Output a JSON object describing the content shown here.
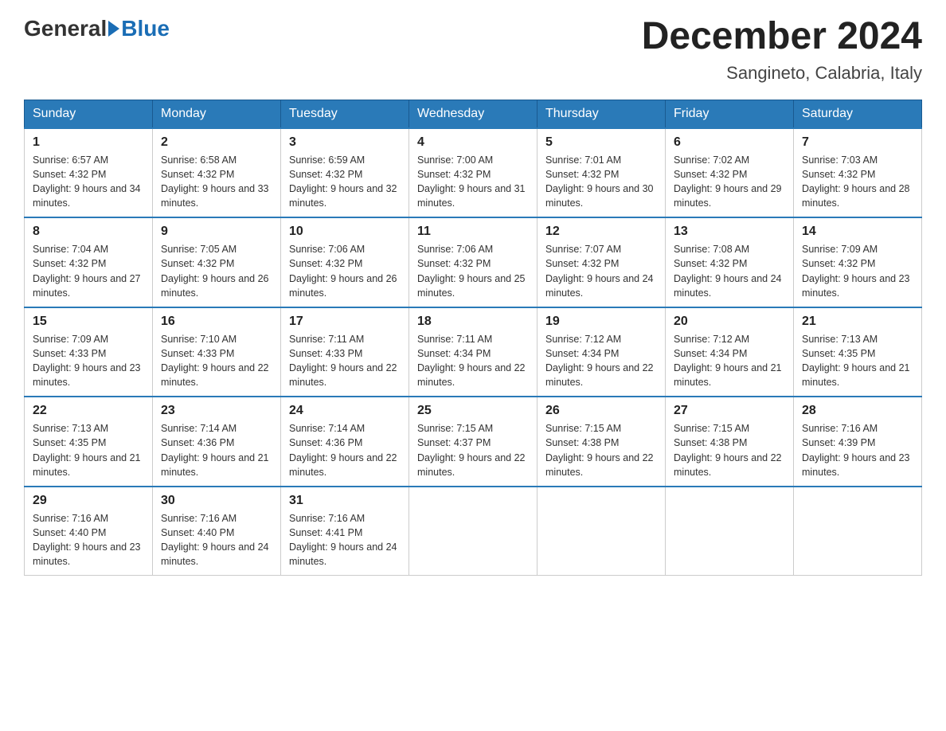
{
  "header": {
    "logo_general": "General",
    "logo_blue": "Blue",
    "month_title": "December 2024",
    "location": "Sangineto, Calabria, Italy"
  },
  "days_of_week": [
    "Sunday",
    "Monday",
    "Tuesday",
    "Wednesday",
    "Thursday",
    "Friday",
    "Saturday"
  ],
  "weeks": [
    [
      {
        "day": "1",
        "sunrise": "Sunrise: 6:57 AM",
        "sunset": "Sunset: 4:32 PM",
        "daylight": "Daylight: 9 hours and 34 minutes."
      },
      {
        "day": "2",
        "sunrise": "Sunrise: 6:58 AM",
        "sunset": "Sunset: 4:32 PM",
        "daylight": "Daylight: 9 hours and 33 minutes."
      },
      {
        "day": "3",
        "sunrise": "Sunrise: 6:59 AM",
        "sunset": "Sunset: 4:32 PM",
        "daylight": "Daylight: 9 hours and 32 minutes."
      },
      {
        "day": "4",
        "sunrise": "Sunrise: 7:00 AM",
        "sunset": "Sunset: 4:32 PM",
        "daylight": "Daylight: 9 hours and 31 minutes."
      },
      {
        "day": "5",
        "sunrise": "Sunrise: 7:01 AM",
        "sunset": "Sunset: 4:32 PM",
        "daylight": "Daylight: 9 hours and 30 minutes."
      },
      {
        "day": "6",
        "sunrise": "Sunrise: 7:02 AM",
        "sunset": "Sunset: 4:32 PM",
        "daylight": "Daylight: 9 hours and 29 minutes."
      },
      {
        "day": "7",
        "sunrise": "Sunrise: 7:03 AM",
        "sunset": "Sunset: 4:32 PM",
        "daylight": "Daylight: 9 hours and 28 minutes."
      }
    ],
    [
      {
        "day": "8",
        "sunrise": "Sunrise: 7:04 AM",
        "sunset": "Sunset: 4:32 PM",
        "daylight": "Daylight: 9 hours and 27 minutes."
      },
      {
        "day": "9",
        "sunrise": "Sunrise: 7:05 AM",
        "sunset": "Sunset: 4:32 PM",
        "daylight": "Daylight: 9 hours and 26 minutes."
      },
      {
        "day": "10",
        "sunrise": "Sunrise: 7:06 AM",
        "sunset": "Sunset: 4:32 PM",
        "daylight": "Daylight: 9 hours and 26 minutes."
      },
      {
        "day": "11",
        "sunrise": "Sunrise: 7:06 AM",
        "sunset": "Sunset: 4:32 PM",
        "daylight": "Daylight: 9 hours and 25 minutes."
      },
      {
        "day": "12",
        "sunrise": "Sunrise: 7:07 AM",
        "sunset": "Sunset: 4:32 PM",
        "daylight": "Daylight: 9 hours and 24 minutes."
      },
      {
        "day": "13",
        "sunrise": "Sunrise: 7:08 AM",
        "sunset": "Sunset: 4:32 PM",
        "daylight": "Daylight: 9 hours and 24 minutes."
      },
      {
        "day": "14",
        "sunrise": "Sunrise: 7:09 AM",
        "sunset": "Sunset: 4:32 PM",
        "daylight": "Daylight: 9 hours and 23 minutes."
      }
    ],
    [
      {
        "day": "15",
        "sunrise": "Sunrise: 7:09 AM",
        "sunset": "Sunset: 4:33 PM",
        "daylight": "Daylight: 9 hours and 23 minutes."
      },
      {
        "day": "16",
        "sunrise": "Sunrise: 7:10 AM",
        "sunset": "Sunset: 4:33 PM",
        "daylight": "Daylight: 9 hours and 22 minutes."
      },
      {
        "day": "17",
        "sunrise": "Sunrise: 7:11 AM",
        "sunset": "Sunset: 4:33 PM",
        "daylight": "Daylight: 9 hours and 22 minutes."
      },
      {
        "day": "18",
        "sunrise": "Sunrise: 7:11 AM",
        "sunset": "Sunset: 4:34 PM",
        "daylight": "Daylight: 9 hours and 22 minutes."
      },
      {
        "day": "19",
        "sunrise": "Sunrise: 7:12 AM",
        "sunset": "Sunset: 4:34 PM",
        "daylight": "Daylight: 9 hours and 22 minutes."
      },
      {
        "day": "20",
        "sunrise": "Sunrise: 7:12 AM",
        "sunset": "Sunset: 4:34 PM",
        "daylight": "Daylight: 9 hours and 21 minutes."
      },
      {
        "day": "21",
        "sunrise": "Sunrise: 7:13 AM",
        "sunset": "Sunset: 4:35 PM",
        "daylight": "Daylight: 9 hours and 21 minutes."
      }
    ],
    [
      {
        "day": "22",
        "sunrise": "Sunrise: 7:13 AM",
        "sunset": "Sunset: 4:35 PM",
        "daylight": "Daylight: 9 hours and 21 minutes."
      },
      {
        "day": "23",
        "sunrise": "Sunrise: 7:14 AM",
        "sunset": "Sunset: 4:36 PM",
        "daylight": "Daylight: 9 hours and 21 minutes."
      },
      {
        "day": "24",
        "sunrise": "Sunrise: 7:14 AM",
        "sunset": "Sunset: 4:36 PM",
        "daylight": "Daylight: 9 hours and 22 minutes."
      },
      {
        "day": "25",
        "sunrise": "Sunrise: 7:15 AM",
        "sunset": "Sunset: 4:37 PM",
        "daylight": "Daylight: 9 hours and 22 minutes."
      },
      {
        "day": "26",
        "sunrise": "Sunrise: 7:15 AM",
        "sunset": "Sunset: 4:38 PM",
        "daylight": "Daylight: 9 hours and 22 minutes."
      },
      {
        "day": "27",
        "sunrise": "Sunrise: 7:15 AM",
        "sunset": "Sunset: 4:38 PM",
        "daylight": "Daylight: 9 hours and 22 minutes."
      },
      {
        "day": "28",
        "sunrise": "Sunrise: 7:16 AM",
        "sunset": "Sunset: 4:39 PM",
        "daylight": "Daylight: 9 hours and 23 minutes."
      }
    ],
    [
      {
        "day": "29",
        "sunrise": "Sunrise: 7:16 AM",
        "sunset": "Sunset: 4:40 PM",
        "daylight": "Daylight: 9 hours and 23 minutes."
      },
      {
        "day": "30",
        "sunrise": "Sunrise: 7:16 AM",
        "sunset": "Sunset: 4:40 PM",
        "daylight": "Daylight: 9 hours and 24 minutes."
      },
      {
        "day": "31",
        "sunrise": "Sunrise: 7:16 AM",
        "sunset": "Sunset: 4:41 PM",
        "daylight": "Daylight: 9 hours and 24 minutes."
      },
      null,
      null,
      null,
      null
    ]
  ]
}
